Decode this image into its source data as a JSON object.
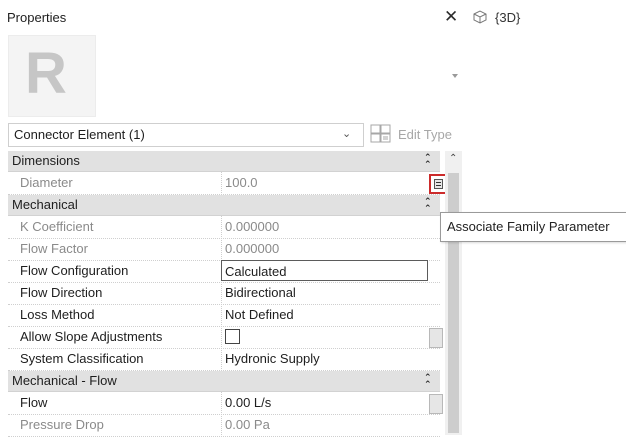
{
  "panel": {
    "title": "Properties",
    "close_glyph": "✕",
    "preview_logo": "R",
    "selector_label": "Connector Element (1)",
    "edit_type_label": "Edit Type"
  },
  "groups": {
    "dimensions": "Dimensions",
    "mechanical": "Mechanical",
    "mechanical_flow": "Mechanical - Flow"
  },
  "rows": {
    "diameter": {
      "name": "Diameter",
      "value": "100.0"
    },
    "k_coefficient": {
      "name": "K Coefficient",
      "value": "0.000000"
    },
    "flow_factor": {
      "name": "Flow Factor",
      "value": "0.000000"
    },
    "flow_configuration": {
      "name": "Flow Configuration",
      "value": "Calculated"
    },
    "flow_direction": {
      "name": "Flow Direction",
      "value": "Bidirectional"
    },
    "loss_method": {
      "name": "Loss Method",
      "value": "Not Defined"
    },
    "allow_slope": {
      "name": "Allow Slope Adjustments",
      "checked": false
    },
    "system_classification": {
      "name": "System Classification",
      "value": "Hydronic Supply"
    },
    "flow": {
      "name": "Flow",
      "value": "0.00 L/s"
    },
    "pressure_drop": {
      "name": "Pressure Drop",
      "value": "0.00 Pa"
    }
  },
  "view": {
    "title": "{3D}",
    "icon": "3d-view-icon"
  },
  "tooltip": {
    "text": "Associate Family Parameter"
  },
  "colors": {
    "highlight_border": "#cc2b2b",
    "group_header_bg": "#e1e1e1",
    "readonly_text": "#8a8a8a"
  }
}
